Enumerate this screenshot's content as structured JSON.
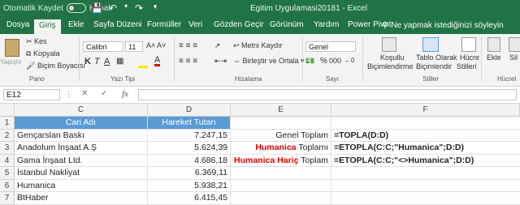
{
  "titlebar": {
    "autosave_label": "Otomatik Kaydet",
    "autosave_state": "Kapalı",
    "title": "Egitim Uygulamasi20181  -  Excel"
  },
  "tabs": [
    "Dosya",
    "Giriş",
    "Ekle",
    "Sayfa Düzeni",
    "Formüller",
    "Veri",
    "Gözden Geçir",
    "Görünüm",
    "Yardım",
    "Power Pivot"
  ],
  "active_tab": "Giriş",
  "tell_me": "Ne yapmak istediğinizi söyleyin",
  "ribbon": {
    "paste": "Yapıştır",
    "cut": "Kes",
    "copy": "Kopyala",
    "format_painter": "Biçim Boyacısı",
    "clipboard_group": "Pano",
    "font_name": "Calibri",
    "font_size": "11",
    "font_group": "Yazı Tipi",
    "wrap_text": "Metni Kaydır",
    "merge_center": "Birleştir ve Ortala",
    "alignment_group": "Hizalama",
    "number_format": "Genel",
    "number_group": "Sayı",
    "conditional_formatting": [
      "Koşullu",
      "Biçimlendirme"
    ],
    "format_as_table": [
      "Tablo Olarak",
      "Biçimlendir"
    ],
    "cell_styles": [
      "Hücre",
      "Stilleri"
    ],
    "styles_group": "Stiller",
    "insert": "Ekle",
    "delete": "Sil",
    "cells_group": "Hücrel",
    "bold": "K",
    "italic": "T",
    "underline": "A",
    "font_color_letter": "A",
    "percent": "%",
    "thousands": "000"
  },
  "formula_bar": {
    "name_box": "E12",
    "fx": "fx",
    "content": ""
  },
  "columns": [
    "C",
    "D",
    "E",
    "F"
  ],
  "rows": [
    {
      "n": "1",
      "c": "Cari Adı",
      "d": "Hareket Tutarı",
      "e_red": "",
      "e": "",
      "f": ""
    },
    {
      "n": "2",
      "c": "Gençarslan Baskı",
      "d": "7.247,15",
      "e_red": "",
      "e": "Genel Toplam",
      "f": "=TOPLA(D:D)"
    },
    {
      "n": "3",
      "c": "Anadolum İnşaat A.Ş",
      "d": "5.624,39",
      "e_red": "Humanica",
      "e": " Toplamı",
      "f": "=ETOPLA(C:C;\"Humanica\";D:D)"
    },
    {
      "n": "4",
      "c": "Gama İnşaat Ltd.",
      "d": "4.686,18",
      "e_red": "Humanica Hariç",
      "e": " Toplam",
      "f": "=ETOPLA(C:C;\"<>Humanica\";D:D)"
    },
    {
      "n": "5",
      "c": "İstanbul Nakliyat",
      "d": "6.369,11",
      "e_red": "",
      "e": "",
      "f": ""
    },
    {
      "n": "6",
      "c": "Humanica",
      "d": "5.938,21",
      "e_red": "",
      "e": "",
      "f": ""
    },
    {
      "n": "7",
      "c": "BtHaber",
      "d": "6.415,45",
      "e_red": "",
      "e": "",
      "f": ""
    }
  ],
  "colors": {
    "excel_green": "#217346",
    "header_blue": "#5b9bd5",
    "highlight_red": "#e00000"
  }
}
